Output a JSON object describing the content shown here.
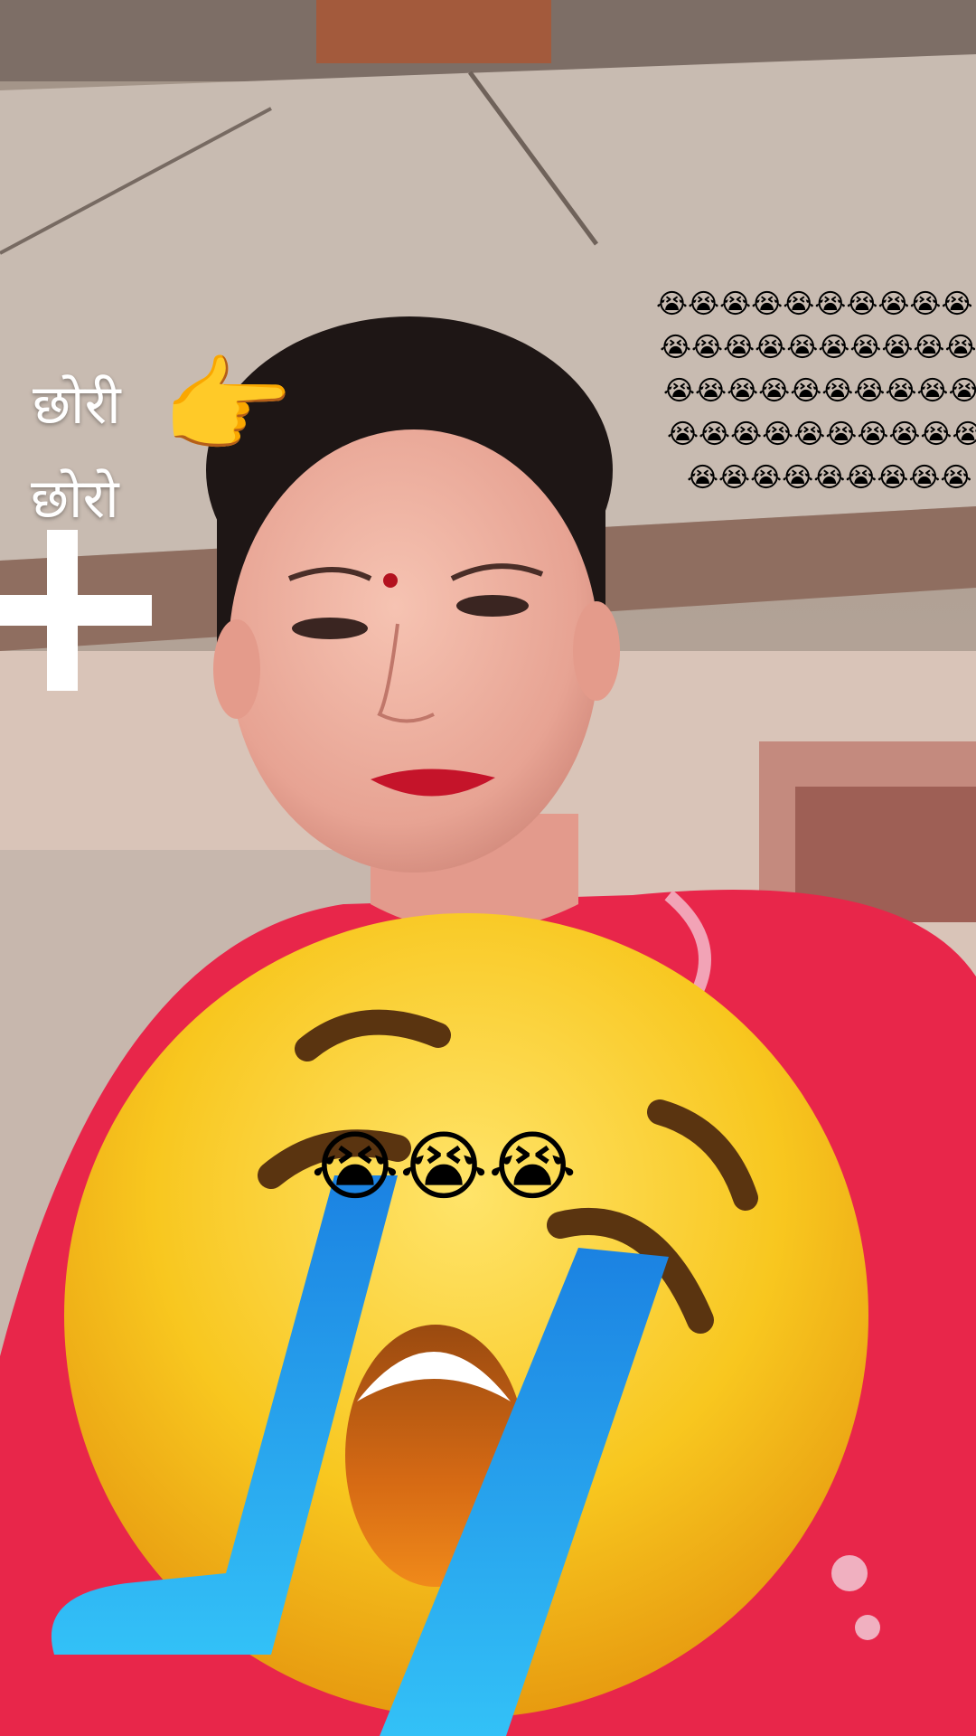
{
  "overlay": {
    "words": [
      "छोरी",
      "छोरो"
    ],
    "pointer_emoji": "👉",
    "plus_symbol": "+",
    "crying_rows": [
      "😭😭😭😭😭😭😭😭😭😭",
      "😭😭😭😭😭😭😭😭😭😭",
      "😭😭😭😭😭😭😭😭😭😭",
      "😭😭😭😭😭😭😭😭😭😭",
      "😭😭😭😭😭😭😭😭😭"
    ],
    "center_crying": "😭😭😭"
  },
  "colors": {
    "wall": "#b9a79c",
    "dress": "#e8264a",
    "emoji_yellow": "#f6c31c",
    "tears_blue": "#2aa6ef",
    "text": "#ffffff"
  }
}
